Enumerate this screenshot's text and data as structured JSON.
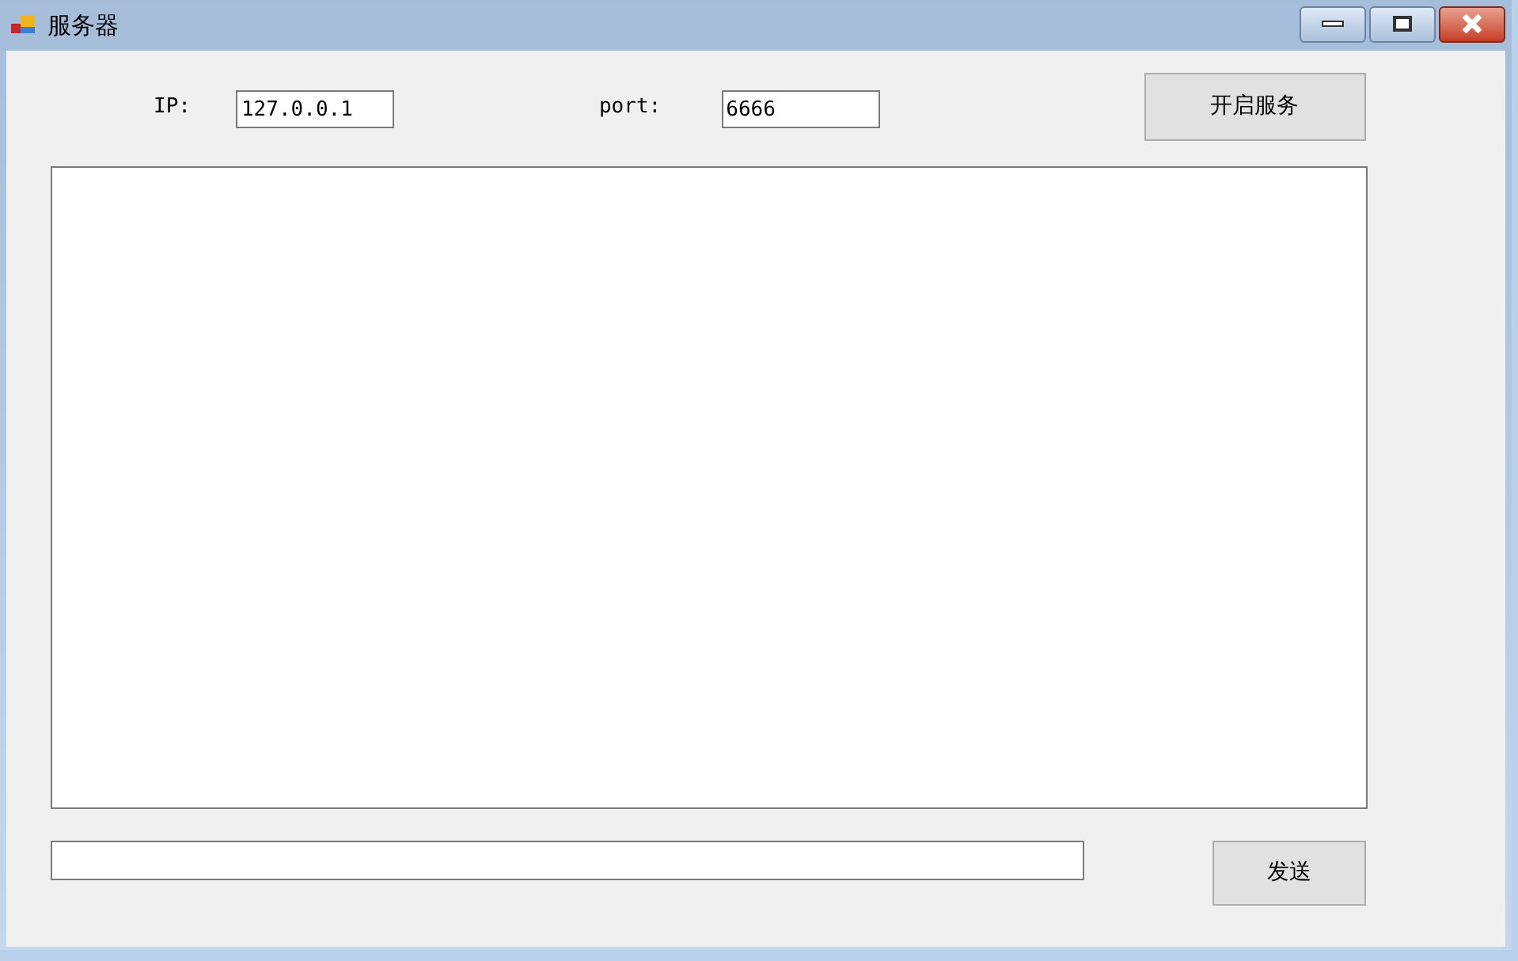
{
  "window": {
    "title": "服务器"
  },
  "ip": {
    "label": "IP:",
    "value": "127.0.0.1"
  },
  "port": {
    "label": "port:",
    "value": "6666"
  },
  "start_button": "开启服务",
  "send_button": "发送"
}
